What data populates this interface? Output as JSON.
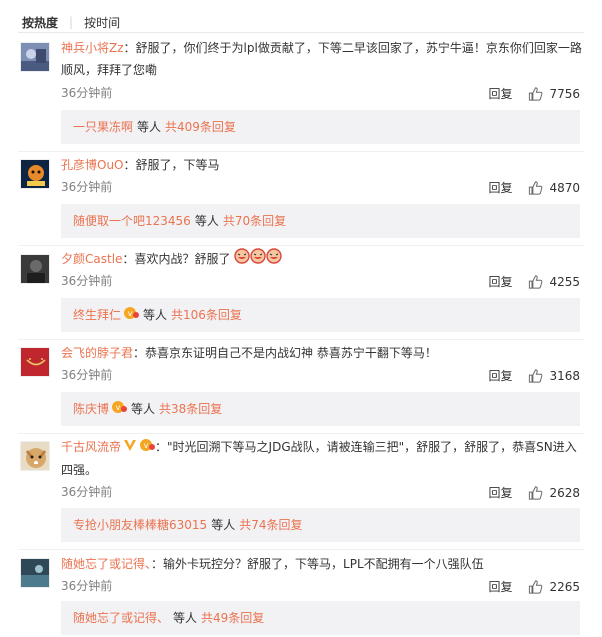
{
  "sort": {
    "hot": "按热度",
    "sep": "|",
    "time": "按时间"
  },
  "comments": [
    {
      "user": "神兵小将Zz",
      "text": "舒服了，你们终于为lpl做贡献了，下等二早该回家了，苏宁牛逼！京东你们回家一路顺风，拜拜了您嘞",
      "time": "36分钟前",
      "reply": "回复",
      "likes": "7756",
      "sub_user": "一只果冻啊",
      "sub_meta": "等人",
      "sub_count": "共409条回复"
    },
    {
      "user": "孔彦博OuO",
      "text": "舒服了，下等马",
      "time": "36分钟前",
      "reply": "回复",
      "likes": "4870",
      "sub_user": "随便取一个吧123456",
      "sub_meta": "等人",
      "sub_count": "共70条回复"
    },
    {
      "user": "夕颜Castle",
      "text": "喜欢内战？舒服了",
      "time": "36分钟前",
      "reply": "回复",
      "likes": "4255",
      "sub_user": "终生拜仁",
      "sub_meta": "等人",
      "sub_count": "共106条回复"
    },
    {
      "user": "会飞的脖子君",
      "text": "恭喜京东证明自己不是内战幻神 恭喜苏宁干翻下等马！",
      "time": "36分钟前",
      "reply": "回复",
      "likes": "3168",
      "sub_user": "陈庆博",
      "sub_meta": "等人",
      "sub_count": "共38条回复"
    },
    {
      "user": "千古风流帝",
      "text": "\"时光回溯下等马之JDG战队，请被连输三把\"，舒服了，舒服了，恭喜SN进入四强。",
      "time": "36分钟前",
      "reply": "回复",
      "likes": "2628",
      "sub_user": "专抢小朋友棒棒糖63015",
      "sub_meta": "等人",
      "sub_count": "共74条回复"
    },
    {
      "user": "随她忘了或记得、",
      "text": "输外卡玩控分？舒服了，下等马，LPL不配拥有一个八强队伍",
      "time": "36分钟前",
      "reply": "回复",
      "likes": "2265",
      "sub_user": "随她忘了或记得、",
      "sub_meta": "等人",
      "sub_count": "共49条回复"
    }
  ],
  "colors": {
    "username": "#eb7350",
    "reply_bg": "#f2f2f5",
    "time": "#808080"
  }
}
